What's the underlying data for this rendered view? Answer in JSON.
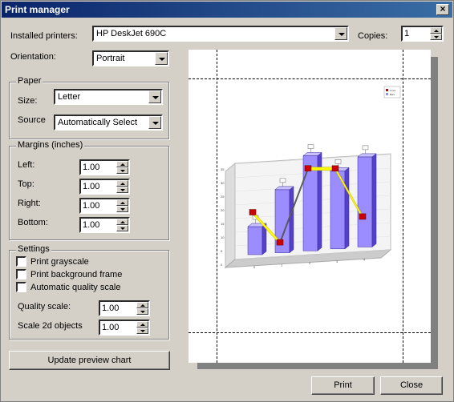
{
  "window": {
    "title": "Print manager"
  },
  "printer": {
    "label": "Installed printers:",
    "value": "HP DeskJet 690C"
  },
  "copies": {
    "label": "Copies:",
    "value": "1"
  },
  "orientation": {
    "label": "Orientation:",
    "value": "Portrait"
  },
  "paper": {
    "legend": "Paper",
    "size_label": "Size:",
    "size_value": "Letter",
    "source_label": "Source",
    "source_value": "Automatically Select"
  },
  "margins": {
    "legend": "Margins (inches)",
    "left_label": "Left:",
    "left_value": "1.00",
    "top_label": "Top:",
    "top_value": "1.00",
    "right_label": "Right:",
    "right_value": "1.00",
    "bottom_label": "Bottom:",
    "bottom_value": "1.00"
  },
  "settings": {
    "legend": "Settings",
    "grayscale": "Print grayscale",
    "background": "Print background frame",
    "auto_quality": "Automatic quality  scale",
    "quality_label": "Quality scale:",
    "quality_value": "1.00",
    "scale2d_label": "Scale 2d objects",
    "scale2d_value": "1.00"
  },
  "buttons": {
    "update": "Update preview chart",
    "print": "Print",
    "close": "Close"
  },
  "preview_chart": {
    "bars": [
      0.28,
      0.63,
      0.95,
      0.78,
      0.9
    ],
    "line": [
      0.42,
      0.1,
      0.82,
      0.8,
      0.3
    ],
    "x_ticks": [
      "0",
      "1",
      "2",
      "3",
      "4"
    ],
    "y_ticks": [
      "0",
      "5",
      "10",
      "15",
      "20",
      "25",
      "30",
      "35"
    ],
    "legend": [
      "Lines",
      "Bars"
    ],
    "colors": {
      "bar": "#9b8cff",
      "bar_side": "#5540c8",
      "line": "#ffff00",
      "marker": "#cc0000"
    }
  }
}
